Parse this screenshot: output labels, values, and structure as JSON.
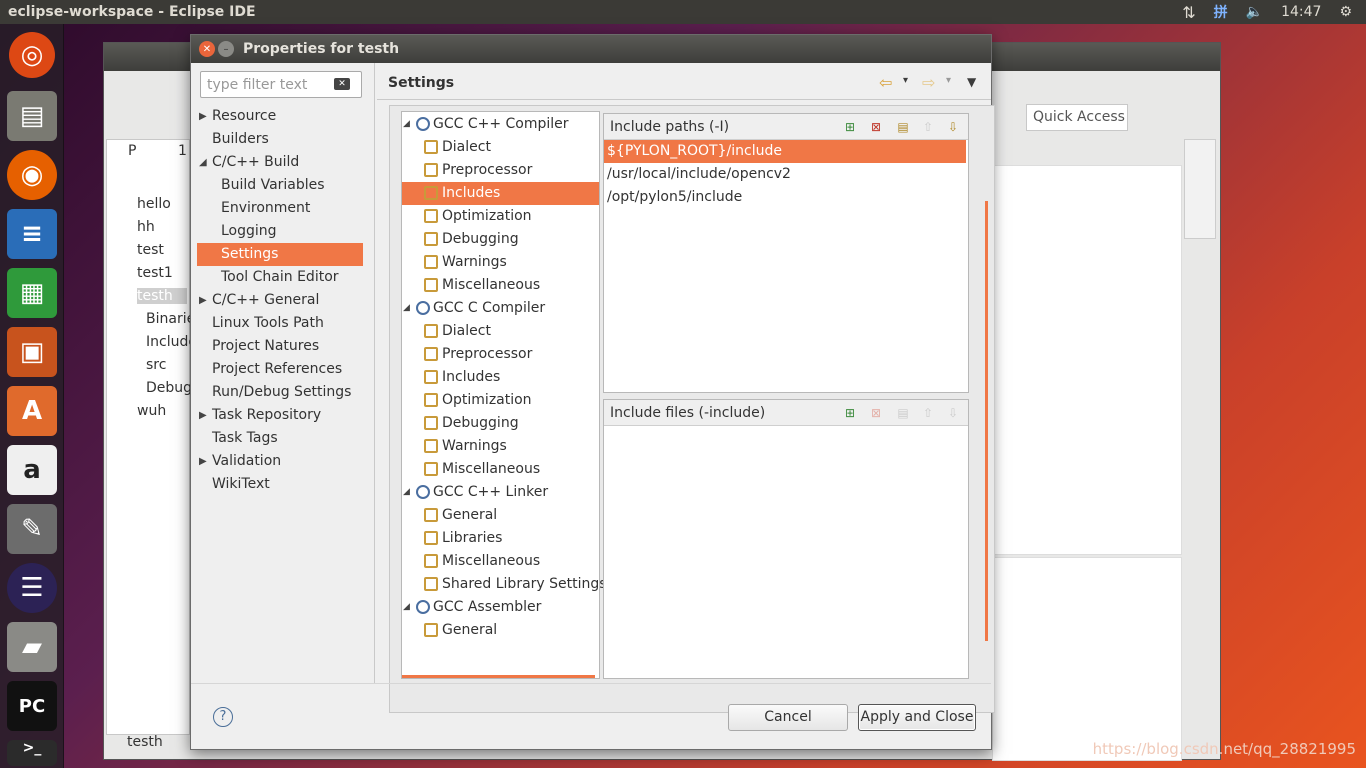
{
  "topbar": {
    "title": "eclipse-workspace - Eclipse IDE",
    "time": "14:47",
    "input_method": "拼"
  },
  "launcher": {
    "items": [
      "ubuntu-icon",
      "files-icon",
      "firefox-icon",
      "writer-icon",
      "calc-icon",
      "impress-icon",
      "software-icon",
      "amazon-icon",
      "settings-icon",
      "eclipse-icon",
      "install-icon",
      "pycharm-icon",
      "terminal-icon"
    ]
  },
  "eclipse": {
    "quick_access": "Quick Access",
    "explorer_tab": "P",
    "explorer_tab2": "1",
    "tree": [
      "hello",
      "hh",
      "test",
      "test1",
      "testh",
      "Binarie",
      "Include",
      "src",
      "Debug",
      "wuh"
    ],
    "status": "testh"
  },
  "dialog": {
    "title": "Properties for testh",
    "filter_placeholder": "type filter text",
    "section_title": "Settings",
    "nav": [
      {
        "label": "Resource",
        "expand": "▶"
      },
      {
        "label": "Builders",
        "expand": ""
      },
      {
        "label": "C/C++ Build",
        "expand": "◢"
      },
      {
        "label": "Build Variables",
        "expand": ""
      },
      {
        "label": "Environment",
        "expand": ""
      },
      {
        "label": "Logging",
        "expand": ""
      },
      {
        "label": "Settings",
        "expand": ""
      },
      {
        "label": "Tool Chain Editor",
        "expand": ""
      },
      {
        "label": "C/C++ General",
        "expand": "▶"
      },
      {
        "label": "Linux Tools Path",
        "expand": ""
      },
      {
        "label": "Project Natures",
        "expand": ""
      },
      {
        "label": "Project References",
        "expand": ""
      },
      {
        "label": "Run/Debug Settings",
        "expand": ""
      },
      {
        "label": "Task Repository",
        "expand": "▶"
      },
      {
        "label": "Task Tags",
        "expand": ""
      },
      {
        "label": "Validation",
        "expand": "▶"
      },
      {
        "label": "WikiText",
        "expand": ""
      }
    ],
    "tools": [
      "GCC C++ Compiler",
      "Dialect",
      "Preprocessor",
      "Includes",
      "Optimization",
      "Debugging",
      "Warnings",
      "Miscellaneous",
      "GCC C Compiler",
      "Dialect",
      "Preprocessor",
      "Includes",
      "Optimization",
      "Debugging",
      "Warnings",
      "Miscellaneous",
      "GCC C++ Linker",
      "General",
      "Libraries",
      "Miscellaneous",
      "Shared Library Settings",
      "GCC Assembler",
      "General"
    ],
    "include_paths_title": "Include paths (-I)",
    "include_paths": [
      "${PYLON_ROOT}/include",
      "/usr/local/include/opencv2",
      "/opt/pylon5/include"
    ],
    "include_files_title": "Include files (-include)",
    "cancel_label": "Cancel",
    "apply_label": "Apply and Close",
    "help_glyph": "?"
  },
  "watermark": "https://blog.csdn.net/qq_28821995",
  "colors": {
    "selection": "#f07746",
    "titlebar": "#3e3e3b"
  }
}
